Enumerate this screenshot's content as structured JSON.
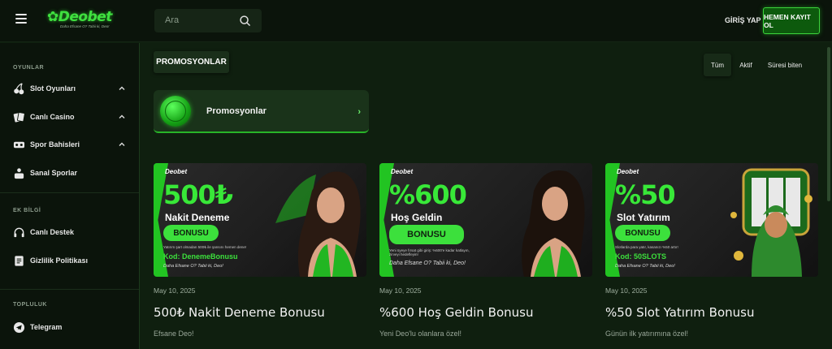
{
  "header": {
    "logo_text": "Deobet",
    "logo_tagline": "Daha Efsane O? Tabii ki, Deo!",
    "search_placeholder": "Ara",
    "login_label": "GİRİŞ YAP",
    "register_label": "HEMEN KAYIT OL"
  },
  "sidebar": {
    "section_games": "OYUNLAR",
    "games": [
      {
        "label": "Slot Oyunları",
        "icon": "cherry-icon"
      },
      {
        "label": "Canlı Casino",
        "icon": "cards-icon"
      },
      {
        "label": "Spor Bahisleri",
        "icon": "sports-icon"
      },
      {
        "label": "Sanal Sporlar",
        "icon": "virtual-sports-icon"
      }
    ],
    "section_info": "EK BİLGİ",
    "info": [
      {
        "label": "Canlı Destek",
        "icon": "headset-icon"
      },
      {
        "label": "Gizlilik Politikası",
        "icon": "document-icon"
      }
    ],
    "section_community": "TOPLULUK",
    "community": [
      {
        "label": "Telegram",
        "icon": "telegram-icon"
      }
    ]
  },
  "main": {
    "section_title": "PROMOSYONLAR",
    "filters": [
      "Tüm",
      "Aktif",
      "Süresi biten"
    ],
    "active_filter": "Tüm",
    "promo_banner_label": "Promosyonlar",
    "cards": [
      {
        "banner": {
          "logo": "Deobet",
          "big": "500₺",
          "sub": "Nakit Deneme",
          "button": "BONUSU",
          "fine": "Yatırım şart olmadan 500₺ ile şansını hemen dene!",
          "code": "Kod: DenemeBonusu",
          "tag": "Daha Efsane O? Tabii ki, Deo!"
        },
        "date": "May 10, 2025",
        "title": "500₺ Nakit Deneme Bonusu",
        "description": "Efsane Deo!"
      },
      {
        "banner": {
          "logo": "Deobet",
          "big": "%600",
          "sub": "Hoş Geldin",
          "button": "BONUSU",
          "fine": "Yeni üyeye fırsat gibi giriş: %600'e kadar katlayın, zirveyi hedefleyin!",
          "code": "",
          "tag": "Daha Efsane O? Tabii ki, Deo!"
        },
        "date": "May 10, 2025",
        "title": "%600 Hoş Geldin Bonusu",
        "description": "Yeni Deo'lu olanlara özel!"
      },
      {
        "banner": {
          "logo": "Deobet",
          "big": "%50",
          "sub": "Slot Yatırım",
          "button": "BONUSU",
          "fine": "Slotlarda para yatır, kasanızı %50 artır!",
          "code": "Kod: 50SLOTS",
          "tag": "Daha Efsane O? Tabii ki, Deo!"
        },
        "date": "May 10, 2025",
        "title": "%50 Slot Yatırım Bonusu",
        "description": "Günün ilk yatırımına özel!"
      }
    ]
  },
  "colors": {
    "accent": "#3ce03c",
    "bg": "#0f1f0f",
    "sidebar_bg": "#0b140b"
  }
}
